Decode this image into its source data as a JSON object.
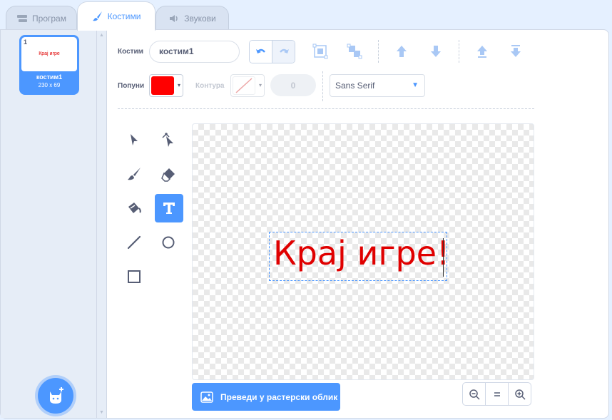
{
  "tabs": [
    {
      "label": "Програм",
      "icon": "code-icon"
    },
    {
      "label": "Костими",
      "icon": "brush-icon"
    },
    {
      "label": "Звукови",
      "icon": "speaker-icon"
    }
  ],
  "costume_list": {
    "items": [
      {
        "number": "1",
        "thumb_text": "Крај игре",
        "name": "костим1",
        "size": "230 x 69"
      }
    ],
    "add_button_icon": "cat-add-icon"
  },
  "toolbar": {
    "costume_label": "Костим",
    "costume_name": "костим1",
    "fill_label": "Попуни",
    "fill_color": "#ff0000",
    "outline_label": "Контура",
    "outline_width": "0",
    "font": "Sans Serif"
  },
  "tools": [
    {
      "name": "select-tool",
      "icon": "arrow-pointer-icon"
    },
    {
      "name": "reshape-tool",
      "icon": "reshape-icon"
    },
    {
      "name": "brush-tool",
      "icon": "brush-icon"
    },
    {
      "name": "eraser-tool",
      "icon": "eraser-icon"
    },
    {
      "name": "fill-tool",
      "icon": "paint-bucket-icon"
    },
    {
      "name": "text-tool",
      "icon": "text-icon",
      "active": true
    },
    {
      "name": "line-tool",
      "icon": "line-icon"
    },
    {
      "name": "circle-tool",
      "icon": "circle-icon"
    },
    {
      "name": "rectangle-tool",
      "icon": "rectangle-icon"
    }
  ],
  "canvas": {
    "text": "Крај игре!",
    "text_color": "#e00000"
  },
  "convert_button": "Преведи у растерски облик",
  "zoom": [
    "zoom-out-icon",
    "zoom-reset-icon",
    "zoom-in-icon"
  ],
  "colors": {
    "accent": "#4c97ff",
    "fill": "#ff0000"
  }
}
